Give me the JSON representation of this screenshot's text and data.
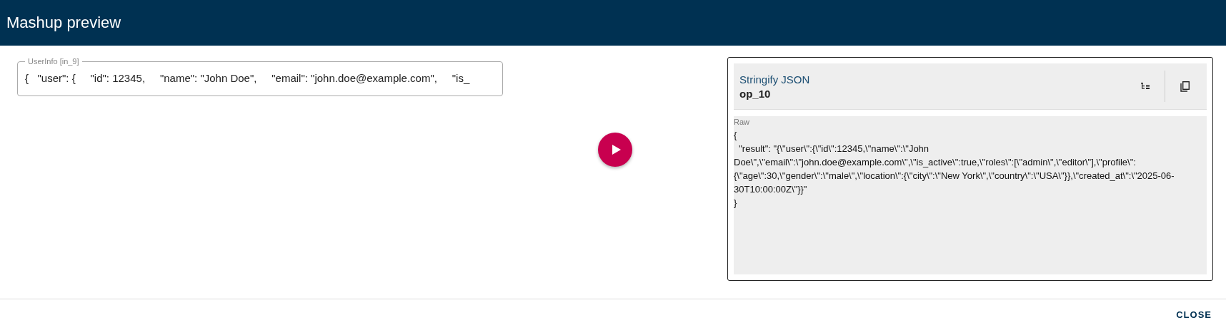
{
  "window": {
    "title": "Mashup preview"
  },
  "input": {
    "label": "UserInfo [in_9]",
    "value": "{   \"user\": {     \"id\": 12345,     \"name\": \"John Doe\",     \"email\": \"john.doe@example.com\",     \"is_"
  },
  "output": {
    "title": "Stringify JSON",
    "id": "op_10",
    "raw_label": "Raw",
    "raw": "{\n  \"result\": \"{\\\"user\\\":{\\\"id\\\":12345,\\\"name\\\":\\\"John Doe\\\",\\\"email\\\":\\\"john.doe@example.com\\\",\\\"is_active\\\":true,\\\"roles\\\":[\\\"admin\\\",\\\"editor\\\"],\\\"profile\\\":{\\\"age\\\":30,\\\"gender\\\":\\\"male\\\",\\\"location\\\":{\\\"city\\\":\\\"New York\\\",\\\"country\\\":\\\"USA\\\"}},\\\"created_at\\\":\\\"2025-06-30T10:00:00Z\\\"}}\"\n}"
  },
  "buttons": [
    "CLOSE"
  ]
}
